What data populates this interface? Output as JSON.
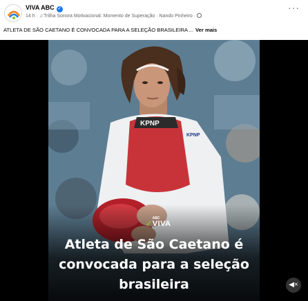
{
  "post": {
    "page_name": "VIVA ABC",
    "time": "14 h",
    "separator": "·",
    "audio": "Trilha Sonora Motivacional: Momento de Superação · Nando Pinheiro",
    "caption": "ATLETA DE SÃO CAETANO É CONVOCADA PARA A SELEÇÃO BRASILEIRA ...",
    "see_more": "Ver mais"
  },
  "video": {
    "logo_small": "ABC",
    "logo_main": "VIVA",
    "headline_lines": [
      "Atleta de São Caetano é",
      "convocada para a seleção",
      "brasileira"
    ],
    "chest_protector_text": "KPNP",
    "sleeve_text": "KPNP"
  },
  "icons": {
    "verified": "verified-badge-icon",
    "music": "music-note-icon",
    "privacy": "globe-icon",
    "more": "more-options-icon",
    "mute": "speaker-muted-icon"
  },
  "colors": {
    "verified_blue": "#1877f2",
    "meta_gray": "#65676b",
    "chest_red": "#c8333a",
    "logo_accent": "#8ac926"
  }
}
